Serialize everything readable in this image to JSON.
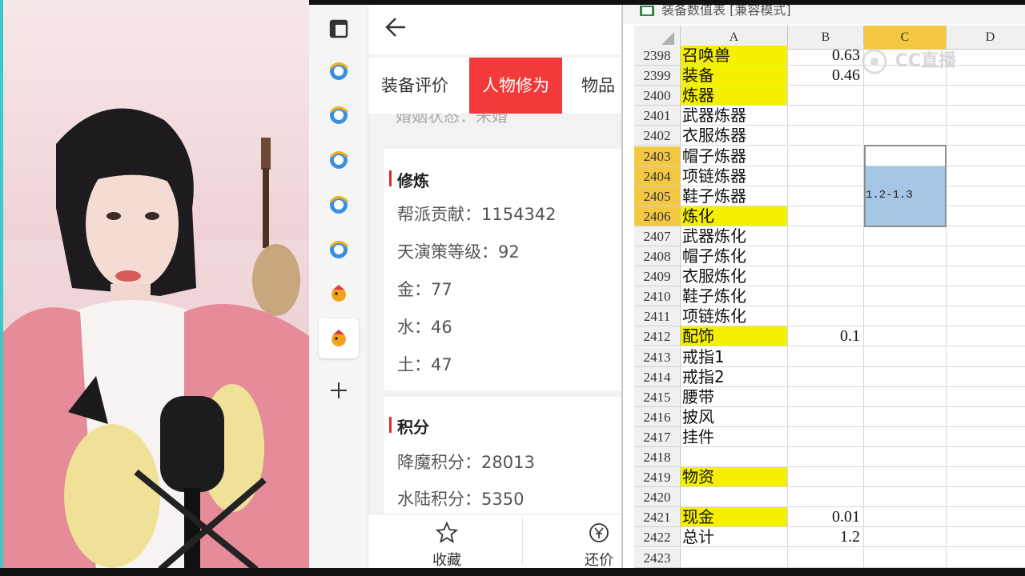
{
  "panel": {
    "tabs": [
      {
        "label": "装备评价"
      },
      {
        "label": "人物修为"
      },
      {
        "label": "物品"
      }
    ],
    "cut_line": "婚姻状态：未婚",
    "cultivation": {
      "title": "修炼",
      "rows": [
        "帮派贡献：1154342",
        "天演策等级：92",
        "金：77",
        "水：46",
        "土：47"
      ]
    },
    "points": {
      "title": "积分",
      "rows": [
        "降魔积分：28013",
        "水陆积分：5350"
      ]
    },
    "bottom": {
      "favorite": "收藏",
      "bargain": "还价"
    }
  },
  "sheet": {
    "title": "装备数值表 [兼容模式]",
    "columns": [
      "A",
      "B",
      "C",
      "D"
    ],
    "selected_column": "C",
    "watermark": "CC直播",
    "selected_cell_text": "1.2-1.3",
    "rows": [
      {
        "num": "2398",
        "a": "召唤兽",
        "b": "0.63",
        "hl": true
      },
      {
        "num": "2399",
        "a": "装备",
        "b": "0.46",
        "hl": true
      },
      {
        "num": "2400",
        "a": "炼器",
        "b": "",
        "hl": true
      },
      {
        "num": "2401",
        "a": "武器炼器",
        "b": "",
        "hl": false
      },
      {
        "num": "2402",
        "a": "衣服炼器",
        "b": "",
        "hl": false
      },
      {
        "num": "2403",
        "a": "帽子炼器",
        "b": "",
        "hl": false,
        "sel": true
      },
      {
        "num": "2404",
        "a": "项链炼器",
        "b": "",
        "hl": false,
        "sel": true
      },
      {
        "num": "2405",
        "a": "鞋子炼器",
        "b": "",
        "hl": false,
        "sel": true
      },
      {
        "num": "2406",
        "a": "炼化",
        "b": "",
        "hl": true,
        "sel": true
      },
      {
        "num": "2407",
        "a": "武器炼化",
        "b": "",
        "hl": false
      },
      {
        "num": "2408",
        "a": "帽子炼化",
        "b": "",
        "hl": false
      },
      {
        "num": "2409",
        "a": "衣服炼化",
        "b": "",
        "hl": false
      },
      {
        "num": "2410",
        "a": "鞋子炼化",
        "b": "",
        "hl": false
      },
      {
        "num": "2411",
        "a": "项链炼化",
        "b": "",
        "hl": false
      },
      {
        "num": "2412",
        "a": "配饰",
        "b": "0.1",
        "hl": true
      },
      {
        "num": "2413",
        "a": "戒指1",
        "b": "",
        "hl": false
      },
      {
        "num": "2414",
        "a": "戒指2",
        "b": "",
        "hl": false
      },
      {
        "num": "2415",
        "a": "腰带",
        "b": "",
        "hl": false
      },
      {
        "num": "2416",
        "a": "披风",
        "b": "",
        "hl": false
      },
      {
        "num": "2417",
        "a": "挂件",
        "b": "",
        "hl": false
      },
      {
        "num": "2418",
        "a": "",
        "b": "",
        "hl": false
      },
      {
        "num": "2419",
        "a": "物资",
        "b": "",
        "hl": true
      },
      {
        "num": "2420",
        "a": "",
        "b": "",
        "hl": false
      },
      {
        "num": "2421",
        "a": "现金",
        "b": "0.01",
        "hl": true
      },
      {
        "num": "2422",
        "a": "总计",
        "b": "1.2",
        "hl": false
      },
      {
        "num": "2423",
        "a": "",
        "b": "",
        "hl": false
      }
    ]
  },
  "colors": {
    "active_tab": "#f23a3a",
    "highlight_cell": "#f5f000",
    "selected_header": "#f5c842",
    "selection_fill": "#a4c6e4",
    "section_bar": "#e32b2b"
  },
  "icons": {
    "iconbar": [
      "window-icon",
      "browser-icon",
      "browser-icon",
      "browser-icon",
      "browser-icon",
      "browser-icon",
      "game-bird-icon",
      "game-bird-icon",
      "plus-icon"
    ]
  }
}
